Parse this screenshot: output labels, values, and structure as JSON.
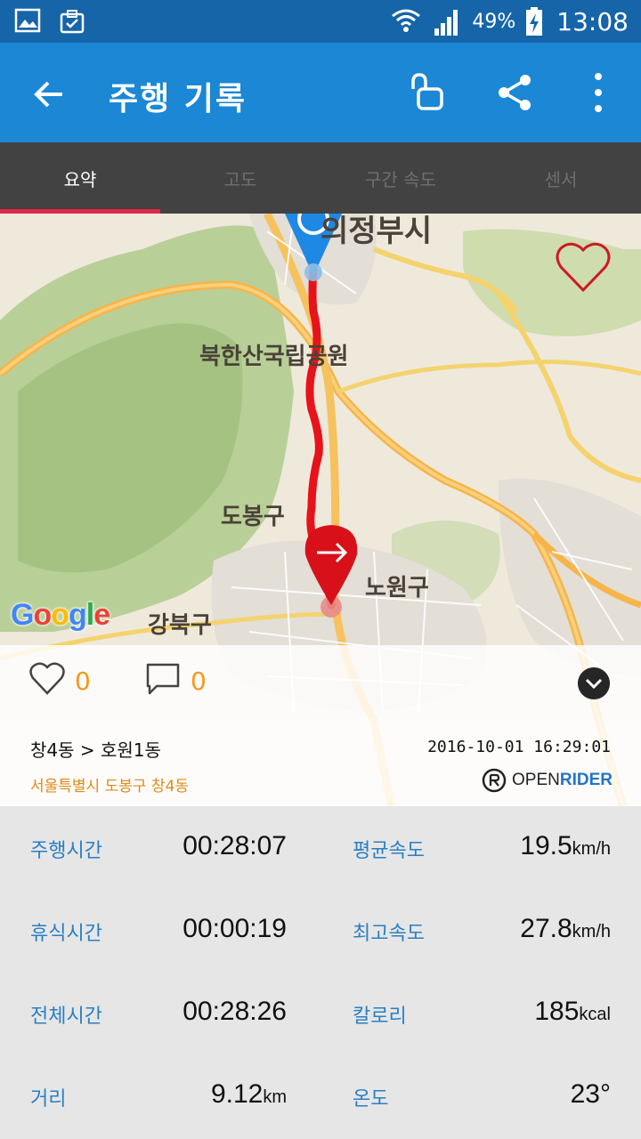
{
  "status_bar": {
    "battery_percent": "49%",
    "time": "13:08"
  },
  "app_bar": {
    "title": "주행 기록"
  },
  "tabs": [
    {
      "label": "요약",
      "active": true
    },
    {
      "label": "고도",
      "active": false
    },
    {
      "label": "구간 속도",
      "active": false
    },
    {
      "label": "센서",
      "active": false
    }
  ],
  "map": {
    "labels": {
      "city_top": "의정부시",
      "park": "북한산국립공원",
      "dobong": "도봉구",
      "nowon": "노원구",
      "gangbuk": "강북구"
    },
    "attribution": "Google"
  },
  "social": {
    "likes": "0",
    "comments": "0"
  },
  "ride_info": {
    "route": "창4동 > 호원1동",
    "address": "서울특별시 도봉구 창4동",
    "datetime": "2016-10-01 16:29:01",
    "brand_part1": "OPEN",
    "brand_part2": "RIDER"
  },
  "stats": [
    {
      "label": "주행시간",
      "value": "00:28:07",
      "unit": ""
    },
    {
      "label": "평균속도",
      "value": "19.5",
      "unit": "km/h"
    },
    {
      "label": "휴식시간",
      "value": "00:00:19",
      "unit": ""
    },
    {
      "label": "최고속도",
      "value": "27.8",
      "unit": "km/h"
    },
    {
      "label": "전체시간",
      "value": "00:28:26",
      "unit": ""
    },
    {
      "label": "칼로리",
      "value": "185",
      "unit": "kcal"
    },
    {
      "label": "거리",
      "value": "9.12",
      "unit": "km"
    },
    {
      "label": "온도",
      "value": "23°",
      "unit": ""
    }
  ],
  "colors": {
    "status_bar": "#1565a8",
    "app_bar": "#1b87d5",
    "tab_bar": "#424242",
    "tab_indicator": "#e0274a",
    "stat_label": "#2a7fc3",
    "count_accent": "#f39a1a",
    "route_line": "#e8121a",
    "start_pin": "#1e88e5",
    "end_pin": "#d8101a"
  }
}
